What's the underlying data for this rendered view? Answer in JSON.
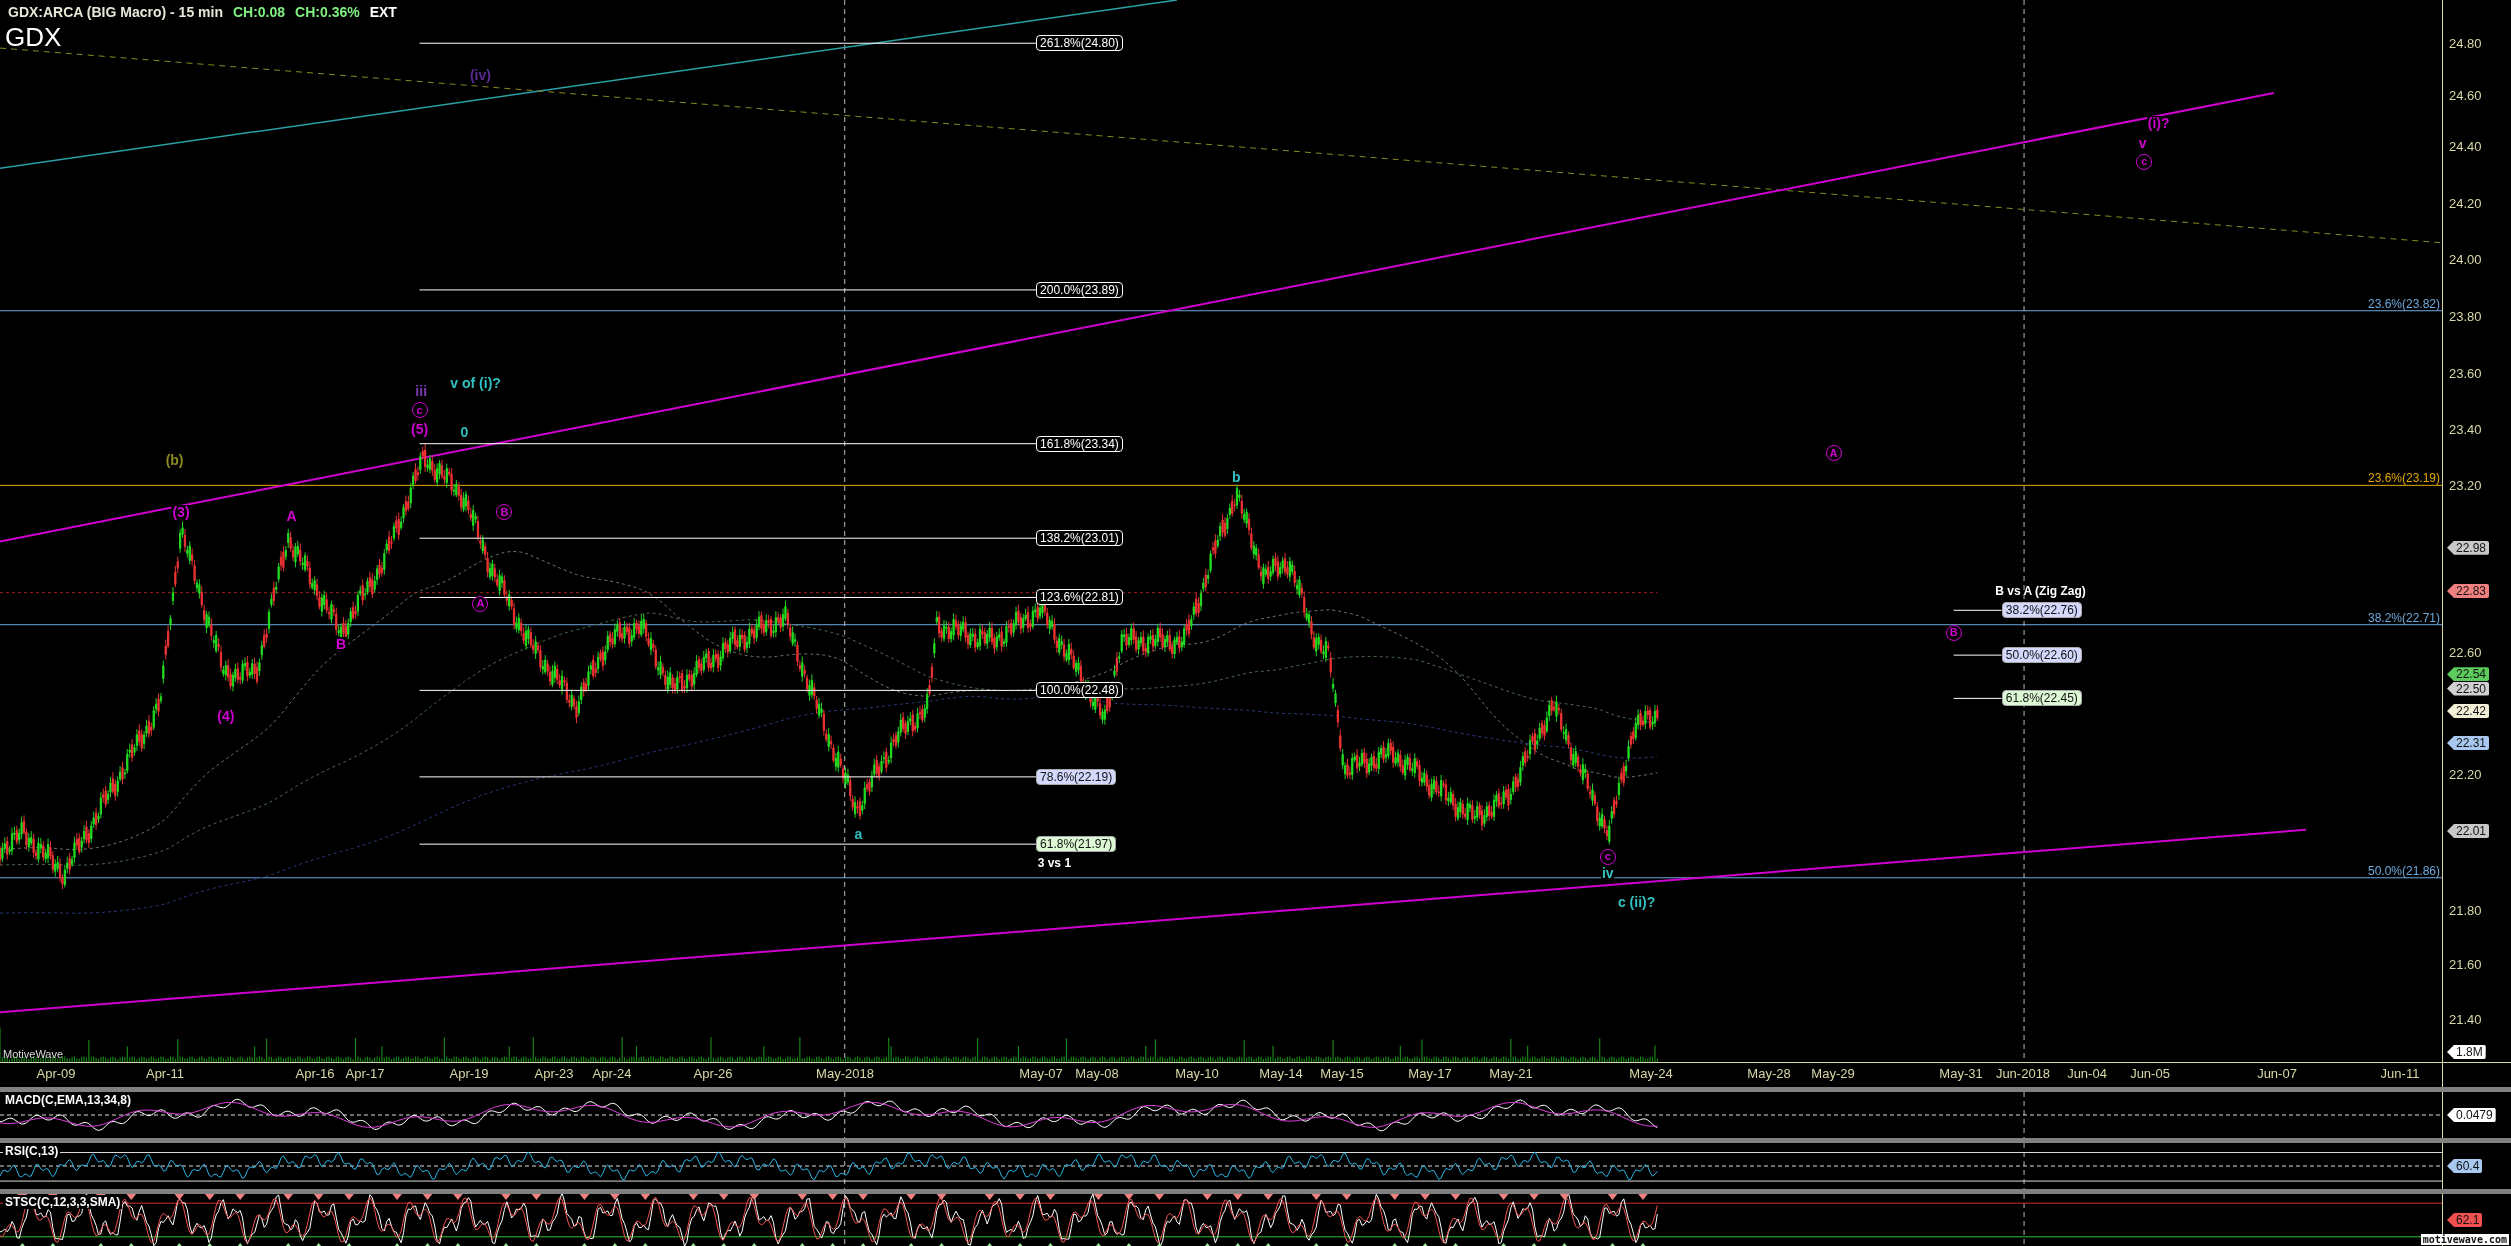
{
  "header": {
    "instrument": "GDX:ARCA (BIG Macro) - 15 min",
    "change": "CH:0.08",
    "change_percent": "CH:0.36%",
    "session": "EXT",
    "symbol": "GDX"
  },
  "price_axis": {
    "ticks": [
      "24.80",
      "24.60",
      "24.40",
      "24.20",
      "24.00",
      "23.80",
      "23.60",
      "23.40",
      "23.20",
      "22.60",
      "22.20",
      "21.80",
      "21.60",
      "21.40"
    ],
    "tags": [
      {
        "text": "22.98",
        "color": "#c8c8c8"
      },
      {
        "text": "22.83",
        "color": "#f08080"
      },
      {
        "text": "22.54",
        "color": "#5ccd5c"
      },
      {
        "text": "22.50",
        "color": "#d0d0d0"
      },
      {
        "text": "22.42",
        "color": "#f4f0d8"
      },
      {
        "text": "22.31",
        "color": "#a8c8f0"
      },
      {
        "text": "22.01",
        "color": "#c8c8c8"
      },
      {
        "text": "1.8M",
        "color": "#ffffff"
      }
    ]
  },
  "fib_left": {
    "levels": [
      {
        "label": "261.8%(24.80)",
        "kind": "outline"
      },
      {
        "label": "200.0%(23.89)",
        "kind": "outline"
      },
      {
        "label": "161.8%(23.34)",
        "kind": "outline"
      },
      {
        "label": "138.2%(23.01)",
        "kind": "outline"
      },
      {
        "label": "123.6%(22.81)",
        "kind": "outline"
      },
      {
        "label": "100.0%(22.48)",
        "kind": "outline"
      },
      {
        "label": "78.6%(22.19)",
        "kind": "blue"
      },
      {
        "label": "61.8%(21.97)",
        "kind": "green"
      }
    ],
    "note": "3 vs 1"
  },
  "fib_right": {
    "title": "B vs A (Zig Zag)",
    "levels": [
      {
        "label": "38.2%(22.76)",
        "kind": "blue"
      },
      {
        "label": "50.0%(22.60)",
        "kind": "blue"
      },
      {
        "label": "61.8%(22.45)",
        "kind": "green"
      }
    ]
  },
  "level_lines": [
    {
      "label": "23.6%(23.82)",
      "color": "#6fa8dc"
    },
    {
      "label": "23.6%(23.19)",
      "color": "#e6a800"
    },
    {
      "label": "38.2%(22.71)",
      "color": "#6fa8dc"
    },
    {
      "label": "50.0%(21.86)",
      "color": "#6fa8dc"
    }
  ],
  "wave_labels": [
    {
      "text": "(iv)",
      "kind": "plain",
      "color": "#5b2a96"
    },
    {
      "text": "(b)",
      "kind": "plain",
      "color": "#8a8a20"
    },
    {
      "text": "(3)",
      "kind": "plain",
      "color": "#d000d0"
    },
    {
      "text": "A",
      "kind": "plain",
      "color": "#d000d0"
    },
    {
      "text": "iii",
      "kind": "plain",
      "color": "#7a3ab0"
    },
    {
      "text": "c",
      "kind": "circled",
      "color": "#d000d0"
    },
    {
      "text": "(5)",
      "kind": "plain",
      "color": "#d000d0"
    },
    {
      "text": "0",
      "kind": "plain",
      "color": "#30c0c0"
    },
    {
      "text": "v of (i)?",
      "kind": "plain",
      "color": "#30c0c0"
    },
    {
      "text": "B",
      "kind": "circled",
      "color": "#d000d0"
    },
    {
      "text": "A",
      "kind": "circled",
      "color": "#d000d0"
    },
    {
      "text": "B",
      "kind": "plain",
      "color": "#d000d0"
    },
    {
      "text": "(4)",
      "kind": "plain",
      "color": "#d000d0"
    },
    {
      "text": "a",
      "kind": "plain",
      "color": "#30c0c0"
    },
    {
      "text": "b",
      "kind": "plain",
      "color": "#30c0c0"
    },
    {
      "text": "A",
      "kind": "circled",
      "color": "#d000d0"
    },
    {
      "text": "B",
      "kind": "circled",
      "color": "#d000d0"
    },
    {
      "text": "c",
      "kind": "circled",
      "color": "#d000d0"
    },
    {
      "text": "iv",
      "kind": "plain",
      "color": "#30c0c0"
    },
    {
      "text": "c (ii)?",
      "kind": "plain",
      "color": "#30c0c0"
    },
    {
      "text": "(i)?",
      "kind": "plain",
      "color": "#d000d0"
    },
    {
      "text": "v",
      "kind": "plain",
      "color": "#d000d0"
    },
    {
      "text": "c",
      "kind": "circled",
      "color": "#d000d0"
    }
  ],
  "app_label": "MotiveWave",
  "date_axis": [
    "Apr-09",
    "Apr-11",
    "Apr-16",
    "Apr-17",
    "Apr-19",
    "Apr-23",
    "Apr-24",
    "Apr-26",
    "May-2018",
    "May-07",
    "May-08",
    "May-10",
    "May-14",
    "May-15",
    "May-17",
    "May-21",
    "May-24",
    "May-28",
    "May-29",
    "May-31",
    "Jun-2018",
    "Jun-04",
    "Jun-05",
    "Jun-07",
    "Jun-11"
  ],
  "indicators": [
    {
      "name": "MACD(C,EMA,13,34,8)",
      "kind": "macd",
      "tag": "0.0479",
      "color": "#ffffff"
    },
    {
      "name": "RSI(C,13)",
      "kind": "rsi",
      "tag": "60.4",
      "color": "#a8c8f0"
    },
    {
      "name": "STSC(C,12,3,3,SMA)",
      "kind": "stsc",
      "tag": "62.1",
      "color": "#f05050"
    }
  ],
  "footer_brand": "motivewave.com"
}
